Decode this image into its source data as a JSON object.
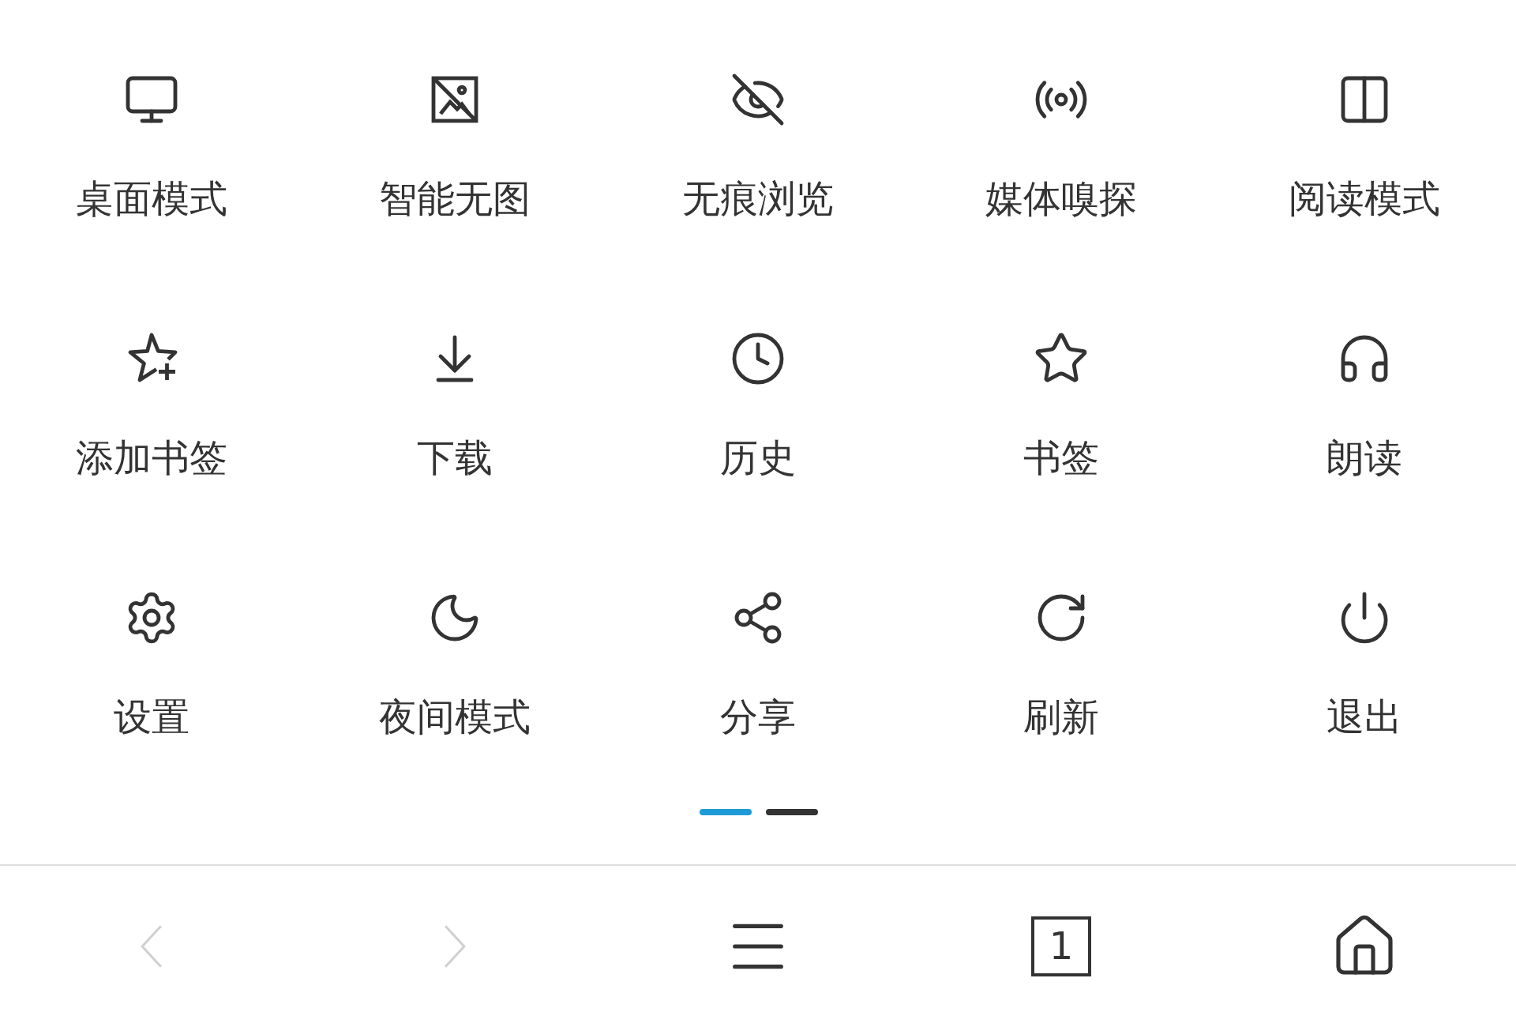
{
  "menu_items": [
    {
      "label": "桌面模式"
    },
    {
      "label": "智能无图"
    },
    {
      "label": "无痕浏览"
    },
    {
      "label": "媒体嗅探"
    },
    {
      "label": "阅读模式"
    },
    {
      "label": "添加书签"
    },
    {
      "label": "下载"
    },
    {
      "label": "历史"
    },
    {
      "label": "书签"
    },
    {
      "label": "朗读"
    },
    {
      "label": "设置"
    },
    {
      "label": "夜间模式"
    },
    {
      "label": "分享"
    },
    {
      "label": "刷新"
    },
    {
      "label": "退出"
    }
  ],
  "page_indicator": [
    {
      "selected": true
    },
    {
      "selected": false
    }
  ],
  "toolbar": {
    "back": {
      "disabled": true
    },
    "forward": {
      "disabled": true
    },
    "tab_count": "1"
  }
}
